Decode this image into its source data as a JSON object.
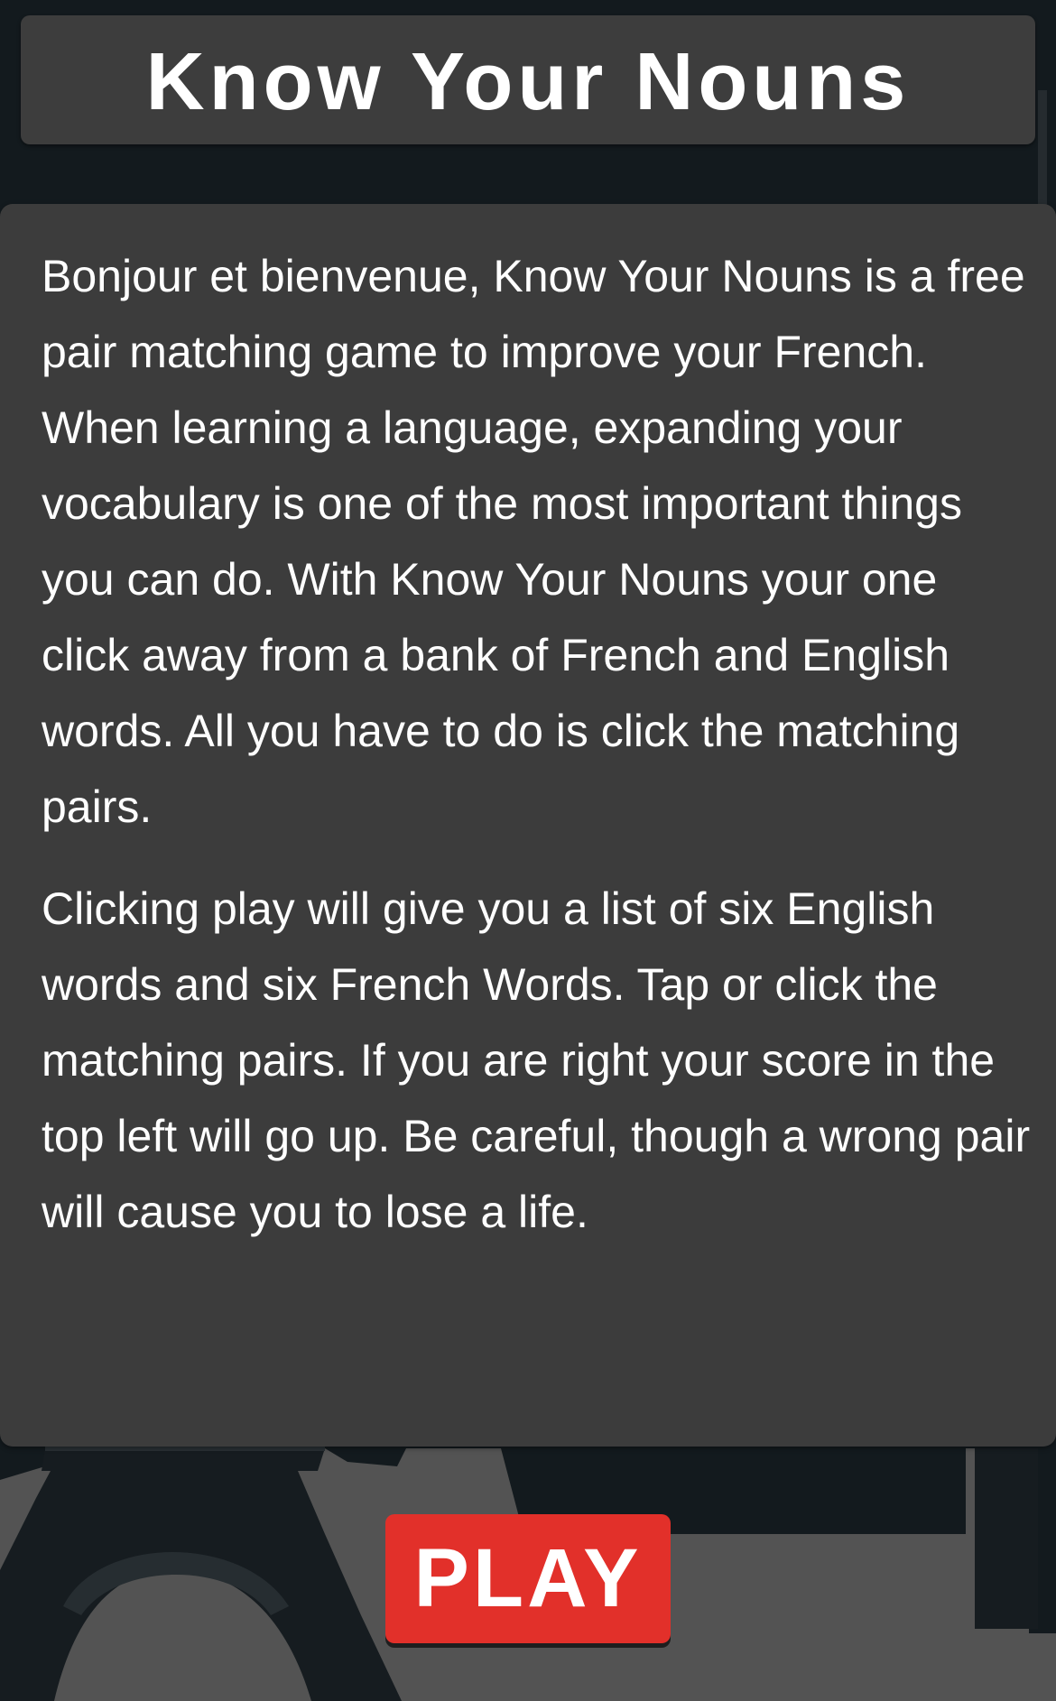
{
  "title": "Know Your Nouns",
  "intro": {
    "paragraph_1": "Bonjour et bienvenue, Know Your Nouns is a free pair matching game to improve your French. When learning a language, expanding your vocabulary is one of the most important things you can do. With Know Your Nouns your one click away from a bank of French and English words. All you have to do is click the matching pairs.",
    "paragraph_2": "Clicking play will give you a list of six English words and six French Words. Tap or click the matching pairs. If you are right your score in the top left will go up. Be careful, though a wrong pair will cause you to lose a life."
  },
  "play_button_label": "PLAY",
  "colors": {
    "background": "#131a1e",
    "panel": "#3c3c3c",
    "title_bar": "#3d3d3d",
    "skyline": "#535353",
    "play_button": "#e2302a",
    "text": "#ffffff"
  },
  "background_scene": "paris-skyline-eiffel-tower"
}
